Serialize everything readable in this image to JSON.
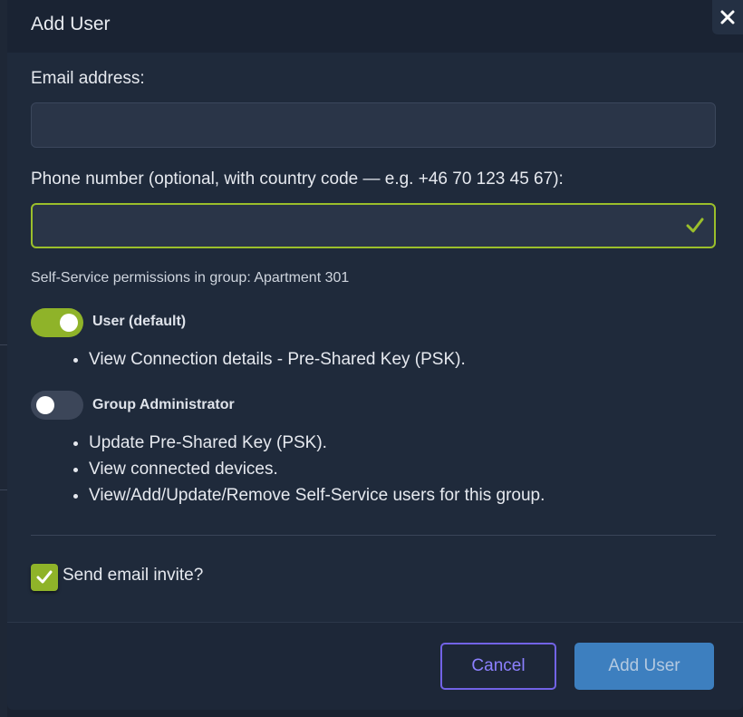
{
  "dialog": {
    "title": "Add User",
    "close_label": "✕"
  },
  "form": {
    "email_label": "Email address:",
    "email_value": "",
    "email_placeholder": "",
    "phone_label": "Phone number (optional, with country code — e.g. +46 70 123 45 67):",
    "phone_value": "",
    "phone_placeholder": "",
    "phone_valid": true
  },
  "permissions": {
    "title": "Self-Service permissions in group: Apartment 301",
    "roles": [
      {
        "label": "User (default)",
        "enabled": true,
        "bullets": [
          "View Connection details - Pre-Shared Key (PSK)."
        ]
      },
      {
        "label": "Group Administrator",
        "enabled": false,
        "bullets": [
          "Update Pre-Shared Key (PSK).",
          "View connected devices.",
          "View/Add/Update/Remove Self-Service users for this group."
        ]
      }
    ]
  },
  "invite": {
    "label": "Send email invite?",
    "checked": true
  },
  "footer": {
    "cancel_label": "Cancel",
    "add_label": "Add User"
  },
  "colors": {
    "accent_green": "#8fb329",
    "cancel_purple": "#7263e6",
    "primary_blue": "#3d7fbf"
  }
}
